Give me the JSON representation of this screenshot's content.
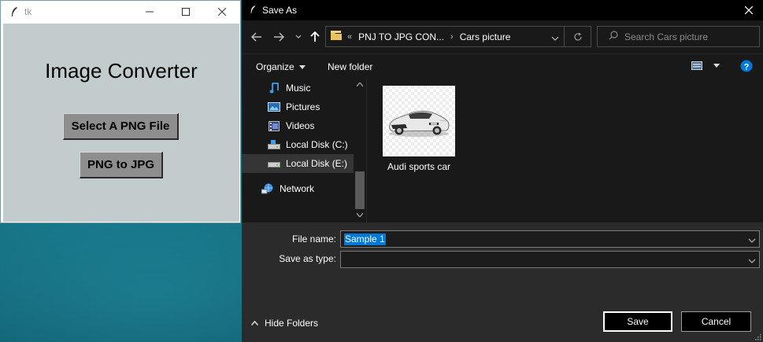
{
  "tk_app": {
    "window_title": "tk",
    "heading": "Image Converter",
    "select_button": "Select A PNG File",
    "convert_button": "PNG to JPG"
  },
  "dialog": {
    "title": "Save As",
    "breadcrumb": {
      "overflow": "«",
      "parent": "PNJ TO JPG CON...",
      "current": "Cars picture"
    },
    "search_placeholder": "Search Cars picture",
    "toolbar": {
      "organize": "Organize",
      "new_folder": "New folder"
    },
    "nav_items": [
      {
        "label": "Music",
        "icon": "music-icon"
      },
      {
        "label": "Pictures",
        "icon": "pictures-icon"
      },
      {
        "label": "Videos",
        "icon": "videos-icon"
      },
      {
        "label": "Local Disk (C:)",
        "icon": "drive-icon"
      },
      {
        "label": "Local Disk (E:)",
        "icon": "drive-icon",
        "selected": true
      },
      {
        "label": "Network",
        "icon": "network-icon"
      }
    ],
    "files": [
      {
        "name": "Audi sports car",
        "icon": "car-thumbnail"
      }
    ],
    "file_name_label": "File name:",
    "file_name_value": "Sample 1",
    "save_type_label": "Save as type:",
    "save_type_value": "",
    "hide_folders": "Hide Folders",
    "save_button": "Save",
    "cancel_button": "Cancel"
  },
  "colors": {
    "tk_body": "#c3cccc",
    "tk_button": "#8e8e8e",
    "dialog_bg": "#2b2b2b",
    "pane_bg": "#191919",
    "selection": "#0078d7",
    "help_icon": "#0078d7"
  }
}
